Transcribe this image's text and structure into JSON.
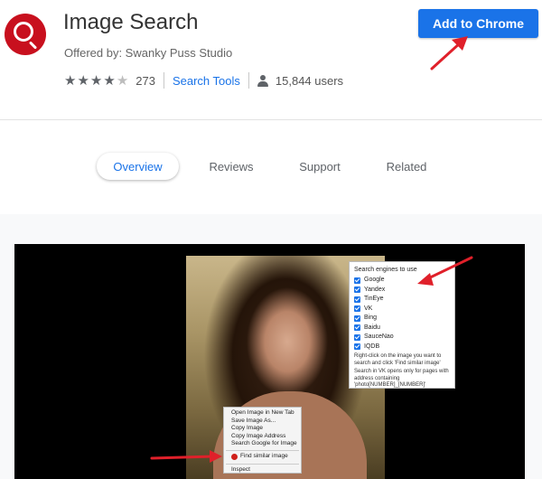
{
  "extension": {
    "title": "Image Search",
    "offered_by": "Offered by: Swanky Puss Studio",
    "rating": 4,
    "rating_max": 5,
    "rating_count": "273",
    "category": "Search Tools",
    "users": "15,844 users",
    "logo_icon": "magnifier-icon"
  },
  "header": {
    "add_button_label": "Add to Chrome"
  },
  "tabs": [
    {
      "label": "Overview",
      "active": true
    },
    {
      "label": "Reviews",
      "active": false
    },
    {
      "label": "Support",
      "active": false
    },
    {
      "label": "Related",
      "active": false
    }
  ],
  "screenshot": {
    "engines_popup": {
      "header": "Search engines to use",
      "engines": [
        "Google",
        "Yandex",
        "TinEye",
        "VK",
        "Bing",
        "Baidu",
        "SauceNao",
        "IQDB"
      ],
      "note1": "Right-click on the image you want to search and click 'Find similar image'",
      "note2": "Search in VK opens only for pages with address containing 'photo[NUMBER]_[NUMBER]'"
    },
    "context_menu": {
      "items": [
        "Open Image in New Tab",
        "Save Image As...",
        "Copy Image",
        "Copy Image Address",
        "Search Google for Image"
      ],
      "find_similar": "Find similar image",
      "inspect": "Inspect"
    }
  },
  "colors": {
    "accent": "#1a73e8",
    "logo": "#c8101e",
    "arrow": "#e0202a"
  }
}
